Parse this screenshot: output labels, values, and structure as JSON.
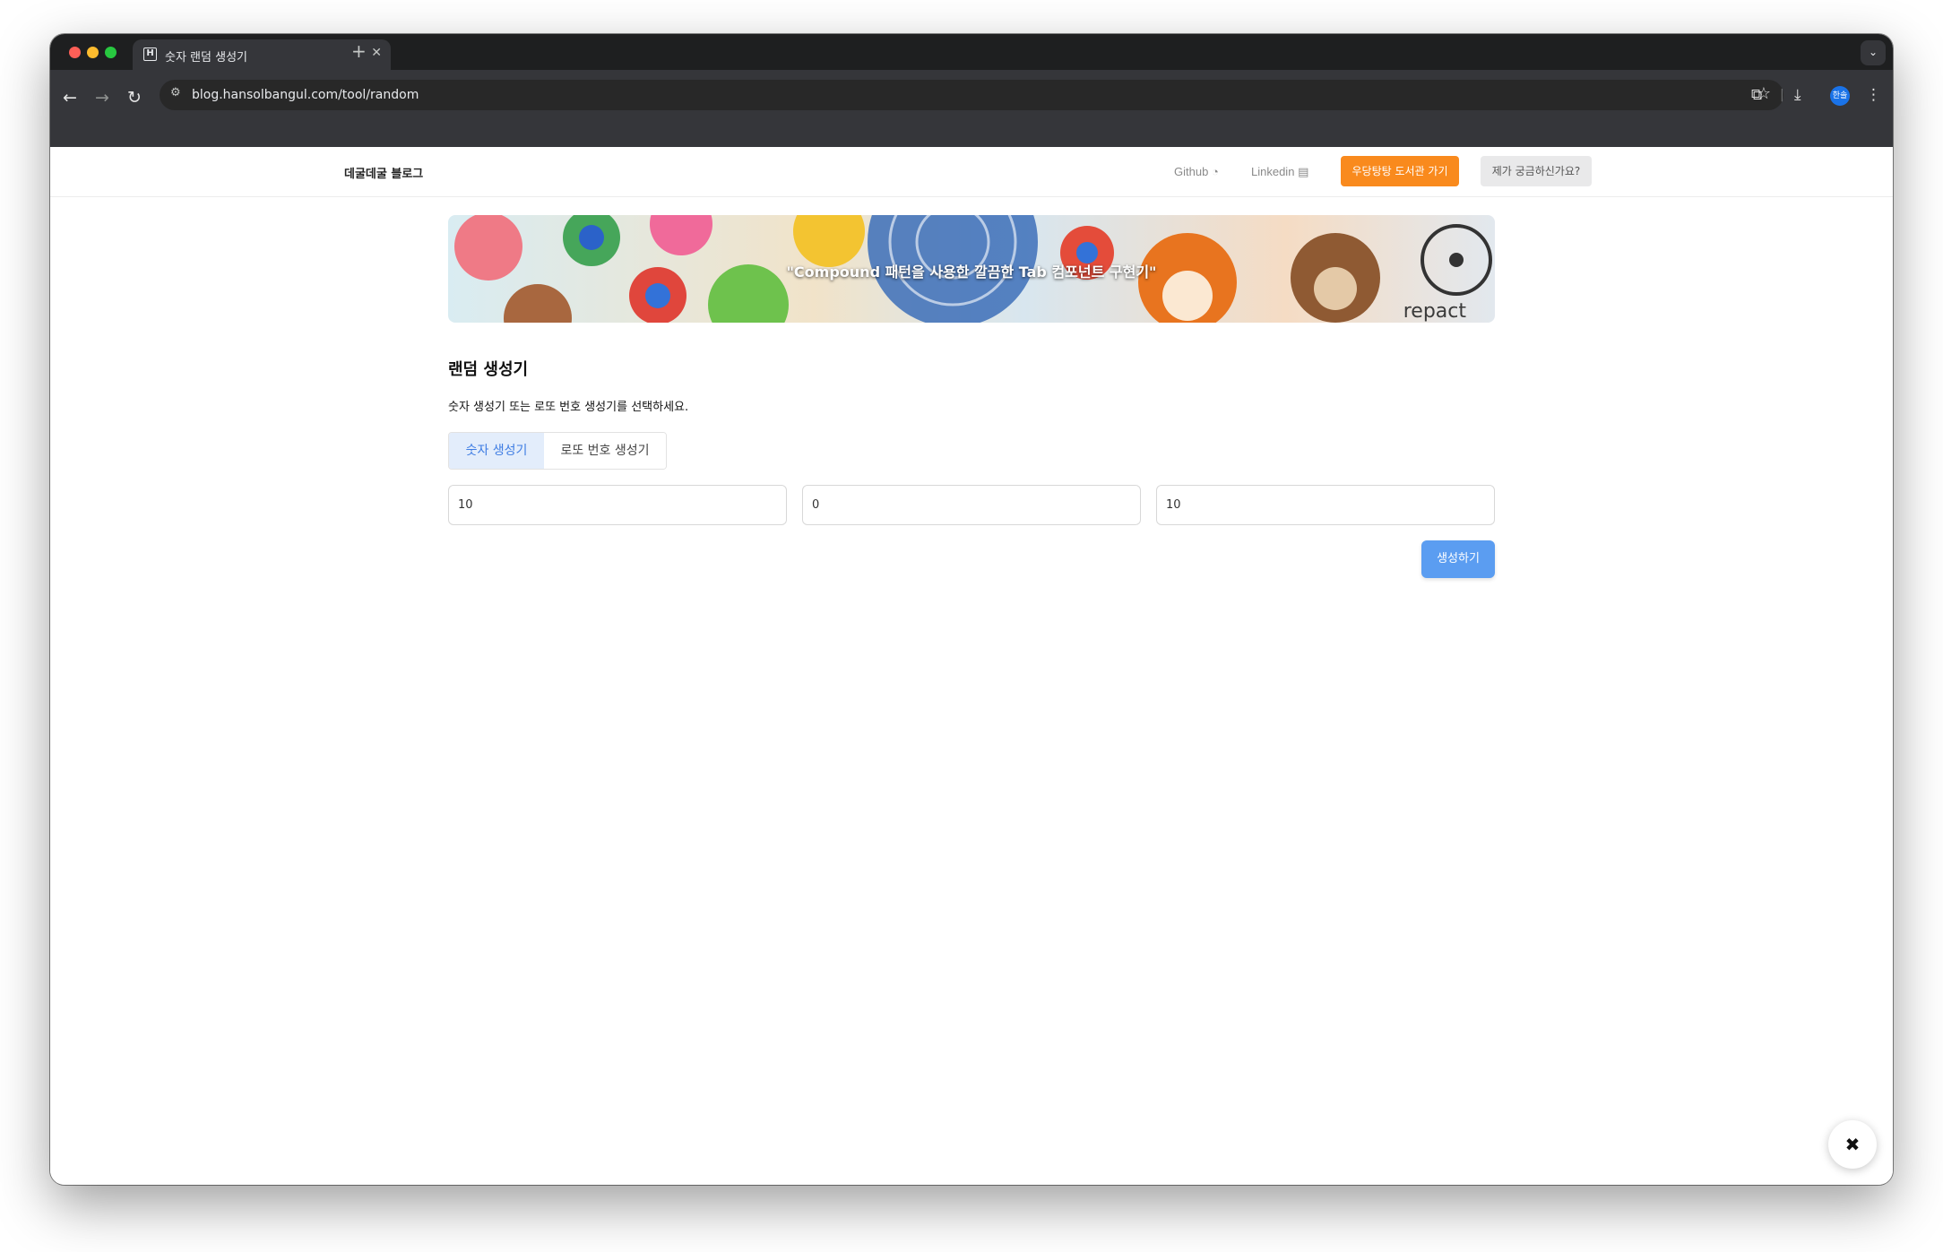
{
  "browser": {
    "tab_title": "숫자 랜덤 생성기",
    "tab_favicon": "H",
    "tab_close": "✕",
    "new_tab": "+",
    "tab_menu": "⌄",
    "url": "blog.hansolbangul.com/tool/random",
    "profile_initials": "한솔"
  },
  "header": {
    "logo": "데굴데굴 블로그",
    "github": "Github",
    "linkedin": "Linkedin",
    "library_button": "우당탕탕 도서관 가기",
    "question_button": "제가 궁금하신가요?"
  },
  "banner": {
    "title": "\"Compound 패턴을 사용한 깔끔한 Tab 컴포넌트 구현기\"",
    "watermark": "repact"
  },
  "main": {
    "title": "랜덤 생성기",
    "description": "숫자 생성기 또는 로또 번호 생성기를 선택하세요.",
    "tabs": [
      {
        "label": "숫자 생성기",
        "active": true
      },
      {
        "label": "로또 번호 생성기",
        "active": false
      }
    ],
    "inputs": [
      "10",
      "0",
      "10"
    ],
    "generate_button": "생성하기"
  },
  "colors": {
    "accent_orange": "#f98a1d",
    "accent_blue": "#5b9df1",
    "active_tab_bg": "#e3edfb"
  },
  "icons": {
    "fab": "wrench-screwdriver-icon"
  }
}
